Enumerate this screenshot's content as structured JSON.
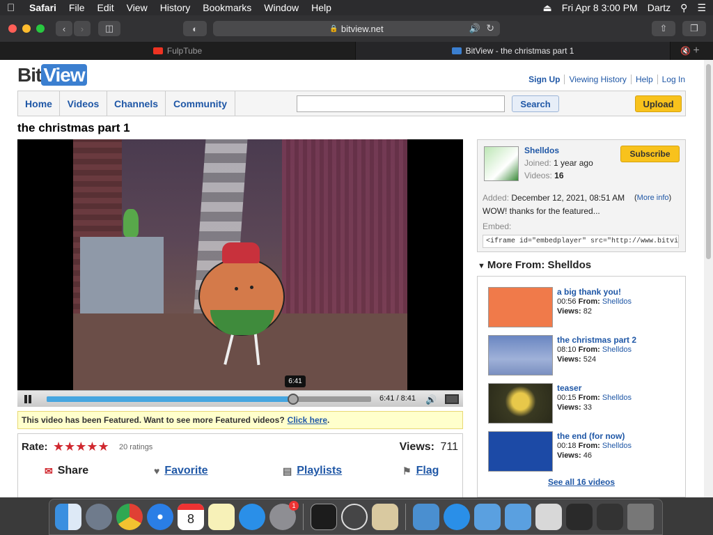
{
  "menubar": {
    "app_name": "Safari",
    "menus": [
      "File",
      "Edit",
      "View",
      "History",
      "Bookmarks",
      "Window",
      "Help"
    ],
    "datetime": "Fri Apr 8  3:00 PM",
    "user": "Dartz"
  },
  "browser": {
    "url": "bitview.net",
    "tabs": [
      {
        "title": "FulpTube",
        "active": false
      },
      {
        "title": "BitView - the christmas part 1",
        "active": true
      }
    ]
  },
  "site": {
    "logo_left": "Bit",
    "logo_right": "View",
    "top_links": [
      "Sign Up",
      "Viewing History",
      "Help",
      "Log In"
    ],
    "nav": [
      "Home",
      "Videos",
      "Channels",
      "Community"
    ],
    "search_value": "",
    "search_button": "Search",
    "upload_button": "Upload"
  },
  "video": {
    "title": "the christmas part 1",
    "progress": 0.76,
    "time": "6:41 / 8:41",
    "tooltip": "6:41",
    "featured_text": "This video has been Featured. Want to see more Featured videos?",
    "featured_link": "Click here",
    "featured_period": ".",
    "rate_label": "Rate:",
    "stars": "★★★★★",
    "ratings": "20 ratings",
    "views_label": "Views:",
    "views_value": "711",
    "actions": {
      "share": "Share",
      "favorite": "Favorite",
      "playlists": "Playlists",
      "flag": "Flag"
    }
  },
  "channel": {
    "name": "Shelldos",
    "joined_label": "Joined:",
    "joined_value": "1 year ago",
    "videos_label": "Videos:",
    "videos_value": "16",
    "subscribe": "Subscribe",
    "added_label": "Added:",
    "added_value": "December 12, 2021, 08:51 AM",
    "more_info": "More info",
    "description": "WOW! thanks for the featured...",
    "embed_label": "Embed:",
    "embed_code": "<iframe id=\"embedplayer\" src=\"http://www.bitview.net/embed"
  },
  "more_from": {
    "heading": "More From: Shelldos",
    "from_label": "From:",
    "views_label": "Views:",
    "items": [
      {
        "title": "a big thank you!",
        "duration": "00:56",
        "channel": "Shelldos",
        "views": "82"
      },
      {
        "title": "the christmas part 2",
        "duration": "08:10",
        "channel": "Shelldos",
        "views": "524"
      },
      {
        "title": "teaser",
        "duration": "00:15",
        "channel": "Shelldos",
        "views": "33"
      },
      {
        "title": "the end (for now)",
        "duration": "00:18",
        "channel": "Shelldos",
        "views": "46"
      }
    ],
    "see_all": "See all 16 videos"
  },
  "dock": {
    "calendar_day": "8",
    "settings_badge": "1"
  }
}
